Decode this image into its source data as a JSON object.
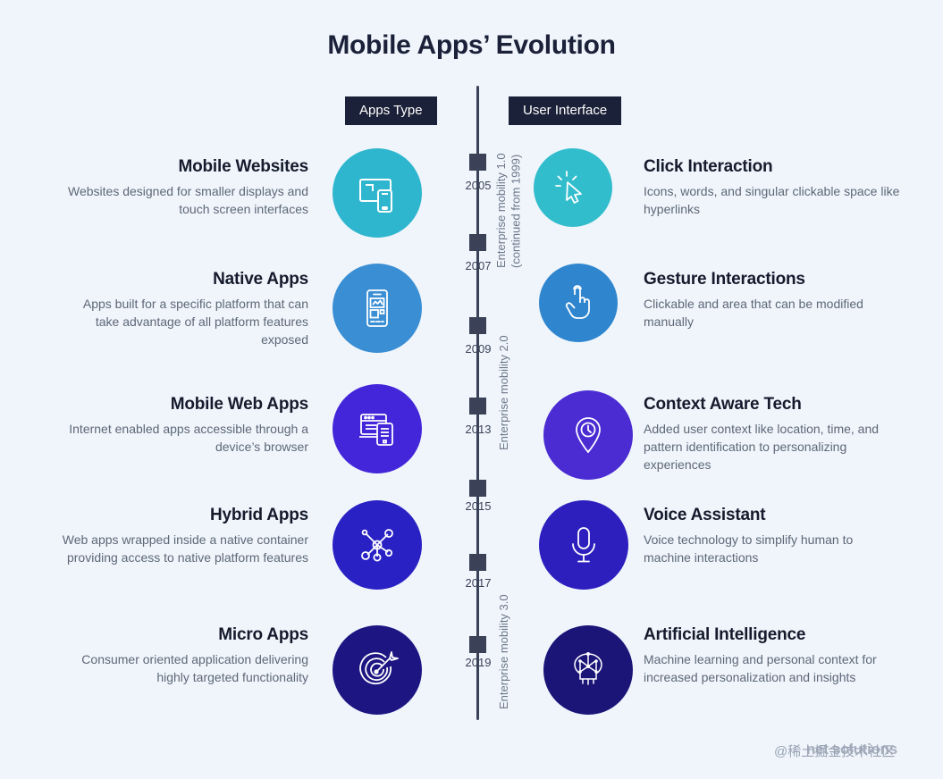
{
  "header": {
    "title": "Mobile Apps’ Evolution",
    "badge_apps_type": "Apps Type",
    "badge_user_interface": "User Interface"
  },
  "timeline": {
    "years": [
      "2005",
      "2007",
      "2009",
      "2013",
      "2015",
      "2017",
      "2019"
    ],
    "phases": [
      "Enterprise mobility 1.0\n(continued from 1999)",
      "Enterprise mobility 2.0",
      "Enterprise mobility 3.0"
    ],
    "axis_color": "#3b4258"
  },
  "rows": [
    {
      "left": {
        "title": "Mobile Websites",
        "desc": "Websites designed for smaller displays and touch screen interfaces",
        "icon": "monitor-phone-icon",
        "color": "#2fb6cf"
      },
      "right": {
        "title": "Click Interaction",
        "desc": "Icons, words, and singular clickable space like hyperlinks",
        "icon": "cursor-click-icon",
        "color": "#32bdcd"
      }
    },
    {
      "left": {
        "title": "Native Apps",
        "desc": "Apps built for a specific platform that can take advantage of all platform features exposed",
        "icon": "smartphone-app-icon",
        "color": "#3a8ed4"
      },
      "right": {
        "title": "Gesture Interactions",
        "desc": "Clickable and area that can be modified manually",
        "icon": "tap-hand-icon",
        "color": "#2f86cf"
      }
    },
    {
      "left": {
        "title": "Mobile Web Apps",
        "desc": "Internet enabled apps accessible through a device’s browser",
        "icon": "browser-tablet-icon",
        "color": "#4326d9"
      },
      "right": {
        "title": "Context Aware Tech",
        "desc": "Added user context like location, time, and pattern identification to personalizing experiences",
        "icon": "location-pin-icon",
        "color": "#4a2cd2"
      }
    },
    {
      "left": {
        "title": "Hybrid Apps",
        "desc": "Web apps wrapped inside a native container providing access to native platform features",
        "icon": "network-nodes-icon",
        "color": "#2a21c4"
      },
      "right": {
        "title": "Voice Assistant",
        "desc": "Voice technology to simplify human to machine interactions",
        "icon": "microphone-icon",
        "color": "#2d1fbe"
      }
    },
    {
      "left": {
        "title": "Micro Apps",
        "desc": "Consumer oriented application delivering highly targeted functionality",
        "icon": "target-dart-icon",
        "color": "#1d1682"
      },
      "right": {
        "title": "Artificial Intelligence",
        "desc": "Machine learning and personal context for increased personalization and insights",
        "icon": "ai-brain-icon",
        "color": "#1b1578"
      }
    }
  ],
  "watermarks": {
    "logo": "net solutions",
    "community": "@稀土掘金技术社区"
  }
}
